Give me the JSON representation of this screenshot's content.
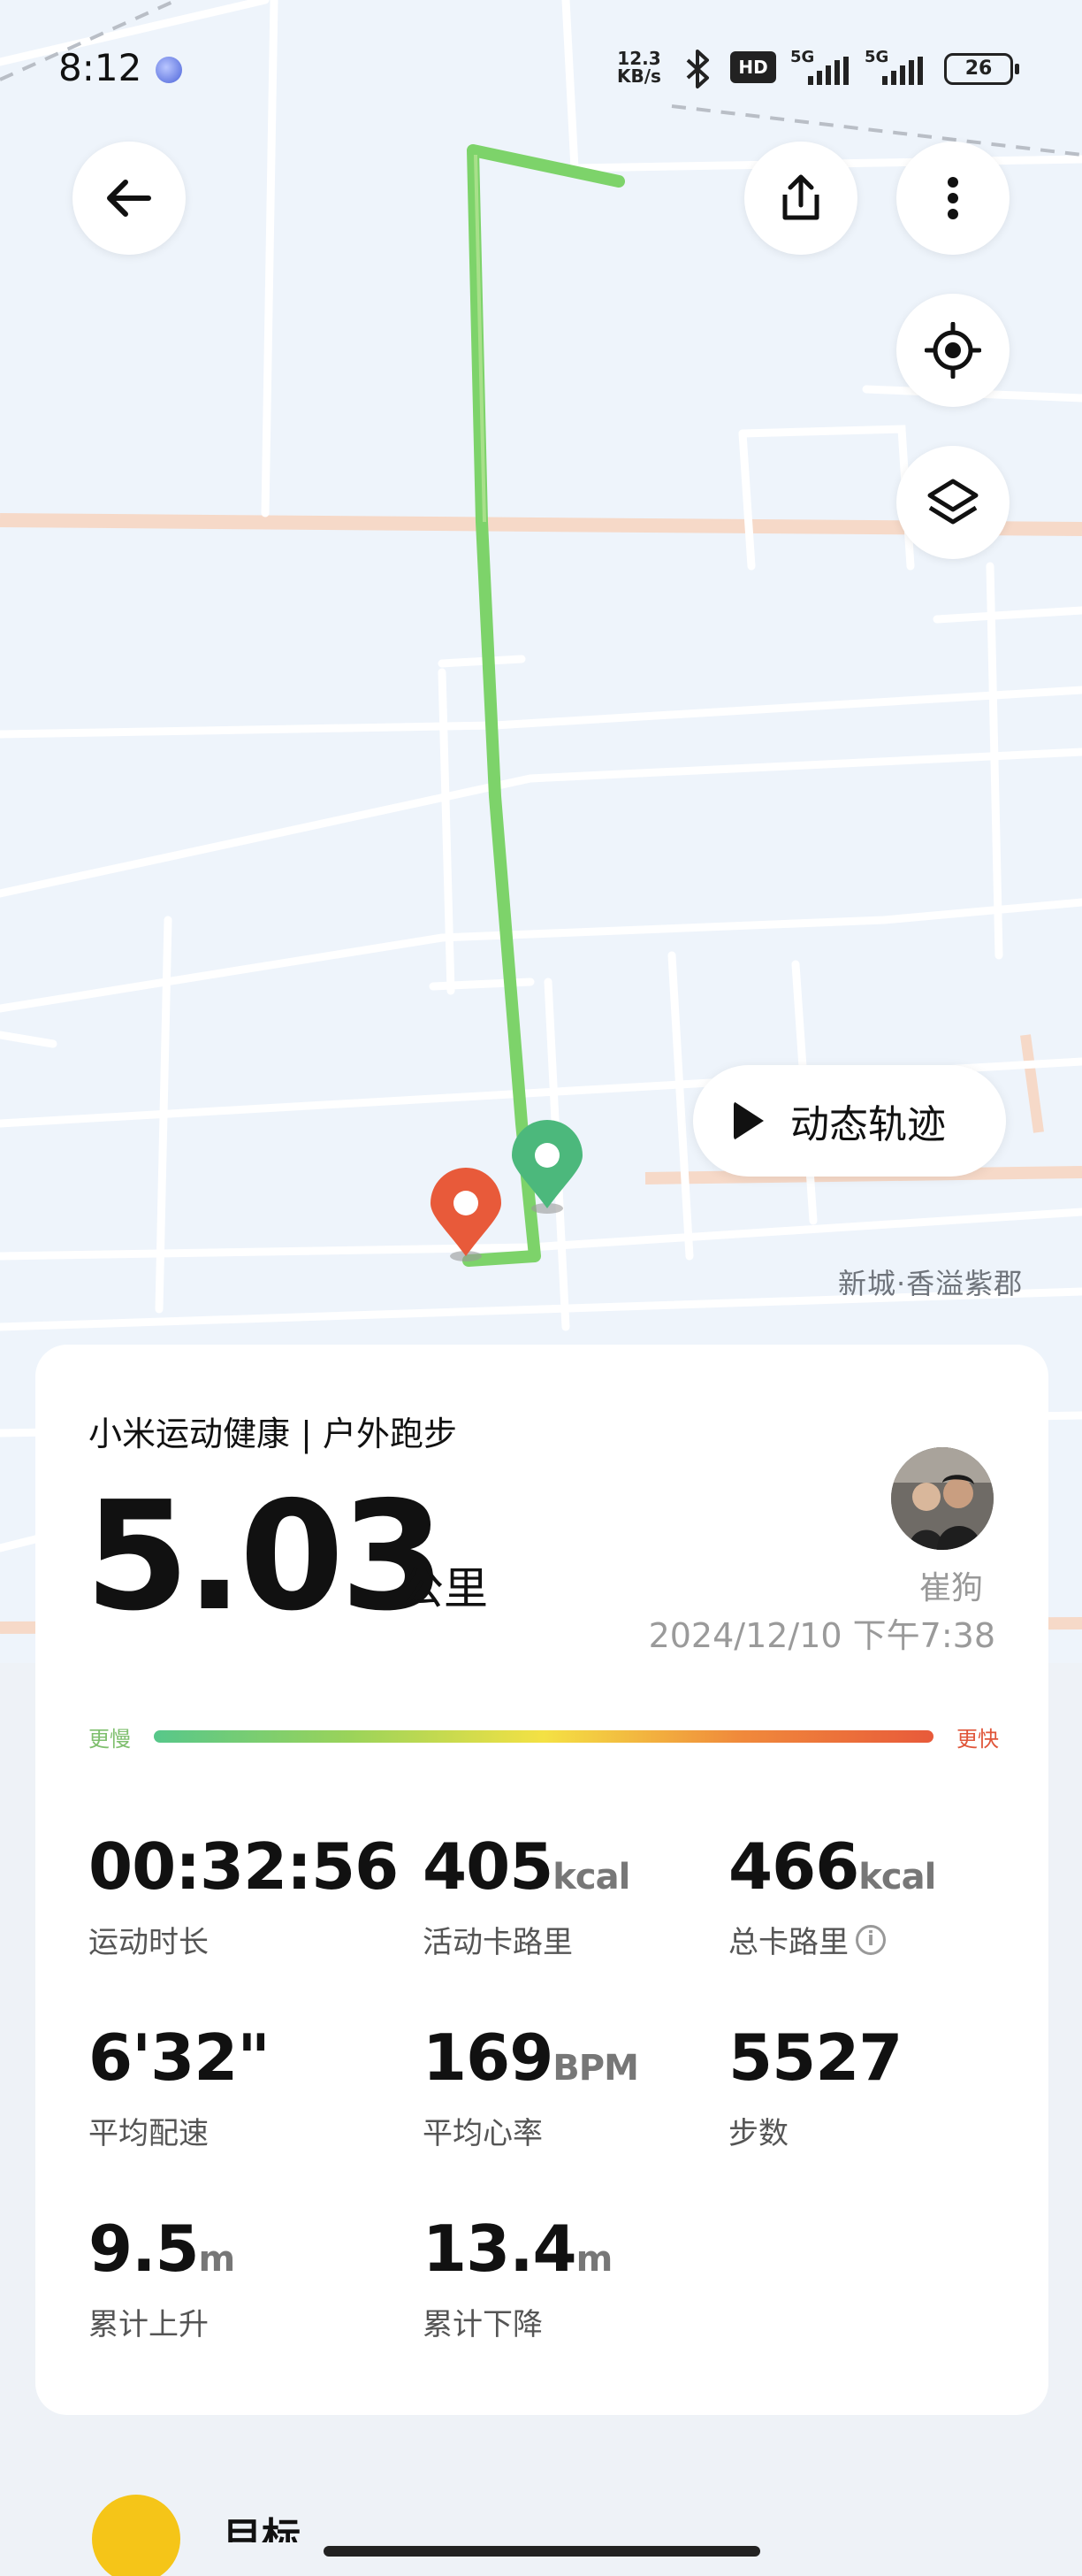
{
  "status_bar": {
    "time": "8:12",
    "net_speed_value": "12.3",
    "net_speed_unit": "KB/s",
    "hd_badge": "HD",
    "signal_1_label": "5G",
    "signal_2_label": "5G",
    "battery": "26"
  },
  "map": {
    "buttons": {
      "back": "arrow-left-icon",
      "share": "share-icon",
      "more": "more-vertical-icon",
      "locate": "locate-icon",
      "layers": "layers-icon"
    },
    "replay_label": "动态轨迹",
    "place_label": "新城·香溢紫郡",
    "colors": {
      "route": "#7dd36a",
      "start_pin": "#4cb87c",
      "end_pin": "#e85a3a"
    }
  },
  "summary": {
    "title": "小米运动健康 | 户外跑步",
    "distance": "5.03",
    "distance_unit": "公里",
    "user_name": "崔狗",
    "datetime": "2024/12/10 下午7:38",
    "pace_slow": "更慢",
    "pace_fast": "更快"
  },
  "stats": [
    {
      "value": "00:32:56",
      "unit": "",
      "label": "运动时长"
    },
    {
      "value": "405",
      "unit": "kcal",
      "label": "活动卡路里"
    },
    {
      "value": "466",
      "unit": "kcal",
      "label": "总卡路里"
    },
    {
      "value": "6'32\"",
      "unit": "",
      "label": "平均配速"
    },
    {
      "value": "169",
      "unit": "BPM",
      "label": "平均心率"
    },
    {
      "value": "5527",
      "unit": "",
      "label": "步数"
    },
    {
      "value": "9.5",
      "unit": "m",
      "label": "累计上升"
    },
    {
      "value": "13.4",
      "unit": "m",
      "label": "累计下降"
    }
  ],
  "bottom": {
    "goal_label": "目标"
  }
}
